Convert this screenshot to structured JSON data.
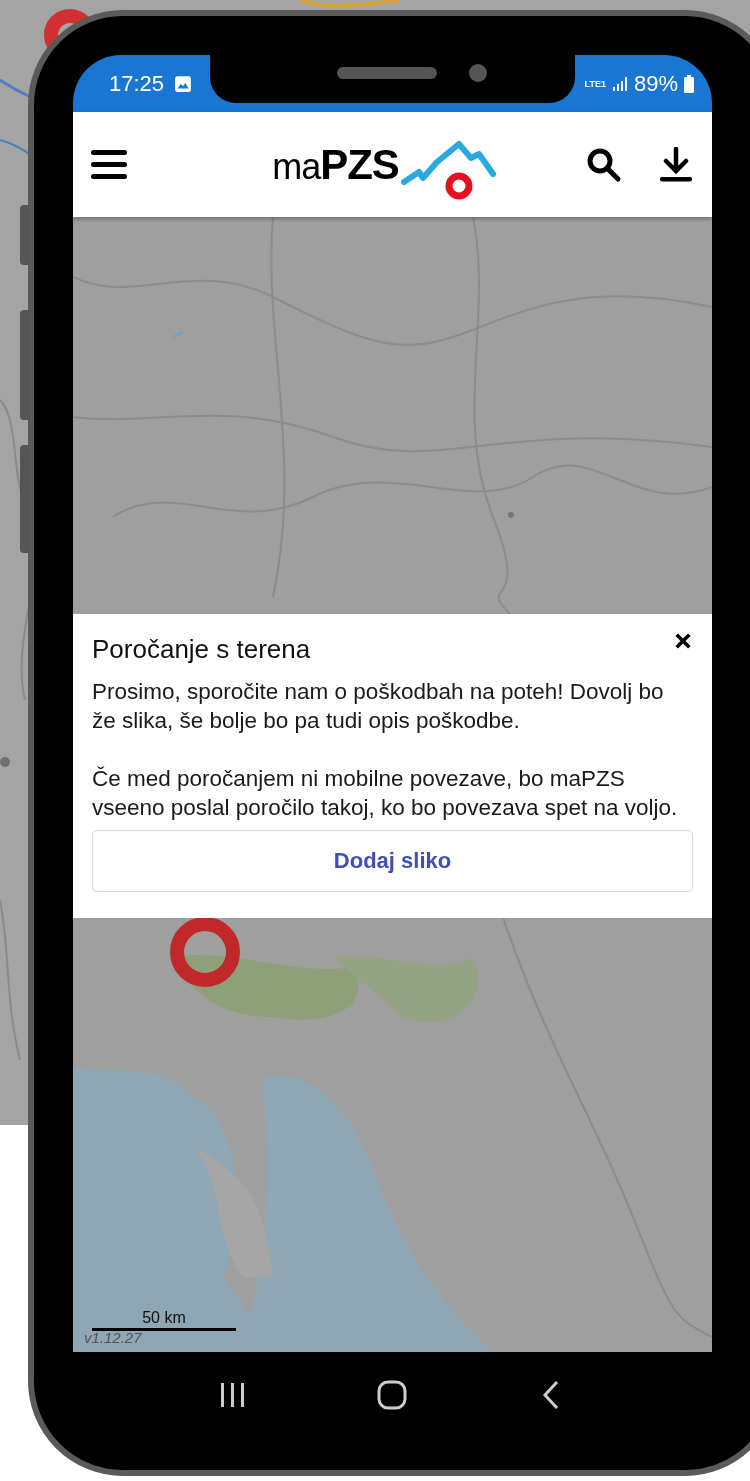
{
  "status_bar": {
    "time": "17:25",
    "network": "LTE1",
    "battery": "89%"
  },
  "header": {
    "logo": "ma**PZS**"
  },
  "map": {
    "kind": "picture",
    "scale_label": "50 km",
    "version": "v1.12.27"
  },
  "dialog": {
    "title": "Poročanje s terena",
    "paragraphs": [
      "Prosimo, sporočite nam o poškodbah na poteh! Dovolj bo že slika, še bolje bo pa tudi opis poškodbe.",
      "Če med poročanjem ni mobilne povezave, bo maPZS vseeno poslal poročilo takoj, ko bo povezava spet na voljo."
    ],
    "button": "Dodaj sliko"
  }
}
